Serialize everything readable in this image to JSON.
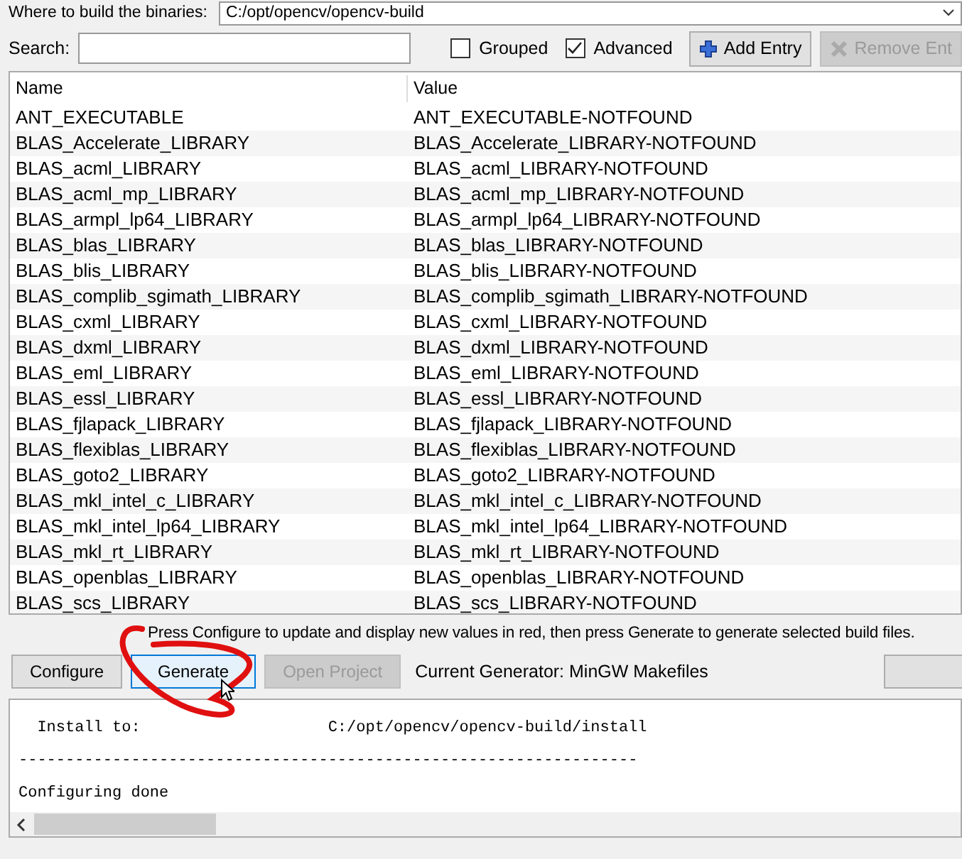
{
  "build_dir": {
    "label": "Where to build the binaries:",
    "value": "C:/opt/opencv/opencv-build"
  },
  "search": {
    "label": "Search:"
  },
  "options": [
    {
      "label": "Grouped",
      "checked": false
    },
    {
      "label": "Advanced",
      "checked": true
    }
  ],
  "toolbar_buttons": [
    {
      "label": "Add Entry",
      "kind": "add",
      "disabled": false
    },
    {
      "label": "Remove Ent",
      "kind": "remove",
      "disabled": true
    }
  ],
  "table": {
    "columns": [
      "Name",
      "Value"
    ],
    "rows": [
      [
        "ANT_EXECUTABLE",
        "ANT_EXECUTABLE-NOTFOUND"
      ],
      [
        "BLAS_Accelerate_LIBRARY",
        "BLAS_Accelerate_LIBRARY-NOTFOUND"
      ],
      [
        "BLAS_acml_LIBRARY",
        "BLAS_acml_LIBRARY-NOTFOUND"
      ],
      [
        "BLAS_acml_mp_LIBRARY",
        "BLAS_acml_mp_LIBRARY-NOTFOUND"
      ],
      [
        "BLAS_armpl_lp64_LIBRARY",
        "BLAS_armpl_lp64_LIBRARY-NOTFOUND"
      ],
      [
        "BLAS_blas_LIBRARY",
        "BLAS_blas_LIBRARY-NOTFOUND"
      ],
      [
        "BLAS_blis_LIBRARY",
        "BLAS_blis_LIBRARY-NOTFOUND"
      ],
      [
        "BLAS_complib_sgimath_LIBRARY",
        "BLAS_complib_sgimath_LIBRARY-NOTFOUND"
      ],
      [
        "BLAS_cxml_LIBRARY",
        "BLAS_cxml_LIBRARY-NOTFOUND"
      ],
      [
        "BLAS_dxml_LIBRARY",
        "BLAS_dxml_LIBRARY-NOTFOUND"
      ],
      [
        "BLAS_eml_LIBRARY",
        "BLAS_eml_LIBRARY-NOTFOUND"
      ],
      [
        "BLAS_essl_LIBRARY",
        "BLAS_essl_LIBRARY-NOTFOUND"
      ],
      [
        "BLAS_fjlapack_LIBRARY",
        "BLAS_fjlapack_LIBRARY-NOTFOUND"
      ],
      [
        "BLAS_flexiblas_LIBRARY",
        "BLAS_flexiblas_LIBRARY-NOTFOUND"
      ],
      [
        "BLAS_goto2_LIBRARY",
        "BLAS_goto2_LIBRARY-NOTFOUND"
      ],
      [
        "BLAS_mkl_intel_c_LIBRARY",
        "BLAS_mkl_intel_c_LIBRARY-NOTFOUND"
      ],
      [
        "BLAS_mkl_intel_lp64_LIBRARY",
        "BLAS_mkl_intel_lp64_LIBRARY-NOTFOUND"
      ],
      [
        "BLAS_mkl_rt_LIBRARY",
        "BLAS_mkl_rt_LIBRARY-NOTFOUND"
      ],
      [
        "BLAS_openblas_LIBRARY",
        "BLAS_openblas_LIBRARY-NOTFOUND"
      ],
      [
        "BLAS_scs_LIBRARY",
        "BLAS_scs_LIBRARY-NOTFOUND"
      ]
    ]
  },
  "hint": "Press Configure to update and display new values in red, then press Generate to generate selected build files.",
  "action_buttons": [
    {
      "label": "Configure",
      "disabled": false,
      "selected": false
    },
    {
      "label": "Generate",
      "disabled": false,
      "selected": true
    },
    {
      "label": "Open Project",
      "disabled": true,
      "selected": false
    }
  ],
  "generator": "Current Generator: MinGW Makefiles",
  "output": [
    "  Install to:                    C:/opt/opencv/opencv-build/install",
    "------------------------------------------------------------------",
    "Configuring done"
  ]
}
